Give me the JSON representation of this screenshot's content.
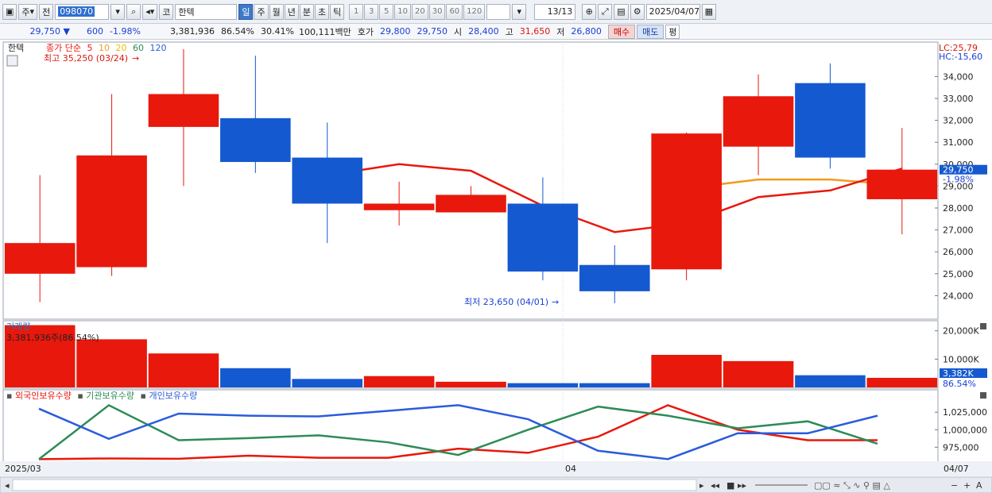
{
  "toolbar": {
    "period_btn": "주",
    "prev_btn": "전",
    "code": "098070",
    "name_prefix": "코",
    "name": "한텍",
    "periods": [
      "일",
      "주",
      "월",
      "년",
      "분",
      "초",
      "틱"
    ],
    "nums": [
      "1",
      "3",
      "5",
      "10",
      "20",
      "30",
      "60",
      "120"
    ],
    "count": "13/13",
    "date": "2025/04/07"
  },
  "quote": {
    "price": "29,750",
    "change": "600",
    "change_pct": "-1.98%",
    "volume": "3,381,936",
    "vol_ratio": "86.54%",
    "turnover": "30.41%",
    "amount": "100,111백만",
    "bid_label": "호가",
    "bid": "29,800",
    "ask": "29,750",
    "open_label": "시",
    "open": "28,400",
    "high_label": "고",
    "high": "31,650",
    "low_label": "저",
    "low": "26,800",
    "buy": "매수",
    "sell": "매도",
    "avg": "평"
  },
  "colors": {
    "up": "#e8180c",
    "down": "#1559d0",
    "ma5": "#e8180c",
    "ma10": "#f29b1d",
    "inst": "#2e8b57",
    "foreign": "#e8180c",
    "indiv": "#2a5cdc"
  },
  "chart_data": [
    {
      "type": "candlestick",
      "title": "한텍",
      "legend_prefix": "종가 단순",
      "ma_periods": [
        "5",
        "10",
        "20",
        "60",
        "120"
      ],
      "annotations": {
        "high": "최고 35,250 (03/24)",
        "low": "최저 23,650 (04/01)",
        "lc": "LC:25,79",
        "hc": "HC:-15,60",
        "current": "29,750",
        "current_pct": "-1.98%"
      },
      "x_labels": [
        "2025/03",
        "04",
        "04/07"
      ],
      "ylim": [
        23000,
        35500
      ],
      "yticks": [
        24000,
        25000,
        26000,
        27000,
        28000,
        29000,
        30000,
        31000,
        32000,
        33000,
        34000
      ],
      "ytick_labels": [
        "24,000",
        "25,000",
        "26,000",
        "27,000",
        "28,000",
        "29,000",
        "30,000",
        "31,000",
        "32,000",
        "33,000",
        "34,000"
      ],
      "candles": [
        {
          "o": 25000,
          "h": 29500,
          "l": 23700,
          "c": 26400
        },
        {
          "o": 25300,
          "h": 33200,
          "l": 24900,
          "c": 30400
        },
        {
          "o": 31700,
          "h": 35250,
          "l": 29000,
          "c": 33200
        },
        {
          "o": 32100,
          "h": 34950,
          "l": 29600,
          "c": 30100
        },
        {
          "o": 30300,
          "h": 31900,
          "l": 26400,
          "c": 28200
        },
        {
          "o": 27900,
          "h": 29200,
          "l": 27200,
          "c": 28200
        },
        {
          "o": 27800,
          "h": 29000,
          "l": 27800,
          "c": 28600
        },
        {
          "o": 28200,
          "h": 29400,
          "l": 24700,
          "c": 25100
        },
        {
          "o": 25400,
          "h": 26300,
          "l": 23650,
          "c": 24200
        },
        {
          "o": 25200,
          "h": 31450,
          "l": 24700,
          "c": 31400
        },
        {
          "o": 30800,
          "h": 34100,
          "l": 29500,
          "c": 33100
        },
        {
          "o": 33700,
          "h": 34600,
          "l": 29800,
          "c": 30300
        },
        {
          "o": 28400,
          "h": 31650,
          "l": 26800,
          "c": 29750
        }
      ],
      "ma5": [
        null,
        null,
        null,
        null,
        29500,
        30000,
        29700,
        28100,
        26900,
        27300,
        28500,
        28800,
        29800
      ],
      "ma10": [
        null,
        null,
        null,
        null,
        null,
        null,
        null,
        null,
        null,
        28900,
        29300,
        29300,
        29050
      ]
    },
    {
      "type": "bar",
      "title": "거래량",
      "label": "3,381,936주(86.54%)",
      "ylim": [
        0,
        23000
      ],
      "yticks": [
        10000,
        20000
      ],
      "ytick_labels": [
        "10,000K",
        "20,000K"
      ],
      "current_label": "3,382K",
      "current_pct": "86.54%",
      "values": [
        22000,
        17000,
        12000,
        6800,
        3000,
        4000,
        2000,
        1500,
        1500,
        11500,
        9300,
        4300,
        3382
      ],
      "directions": [
        "up",
        "up",
        "up",
        "down",
        "down",
        "up",
        "up",
        "down",
        "down",
        "up",
        "up",
        "down",
        "up"
      ]
    },
    {
      "type": "line",
      "series": [
        {
          "name": "외국인보유수량",
          "values": [
            958000,
            959000,
            958500,
            963000,
            960000,
            960000,
            973000,
            967000,
            990000,
            1035000,
            1000000,
            985000,
            985000
          ]
        },
        {
          "name": "기관보유수량",
          "values": [
            958000,
            1035000,
            985000,
            988000,
            992000,
            982000,
            964000,
            1000000,
            1033000,
            1020000,
            1002000,
            1012000,
            980000
          ]
        },
        {
          "name": "개인보유수량",
          "values": [
            1030000,
            987000,
            1023000,
            1020000,
            1019000,
            1027000,
            1035000,
            1015000,
            970000,
            958000,
            995000,
            995000,
            1020000
          ]
        }
      ],
      "ylim": [
        955000,
        1040000
      ],
      "yticks": [
        975000,
        1000000,
        1025000
      ],
      "ytick_labels": [
        "975,000",
        "1,000,000",
        "1,025,000"
      ]
    }
  ]
}
